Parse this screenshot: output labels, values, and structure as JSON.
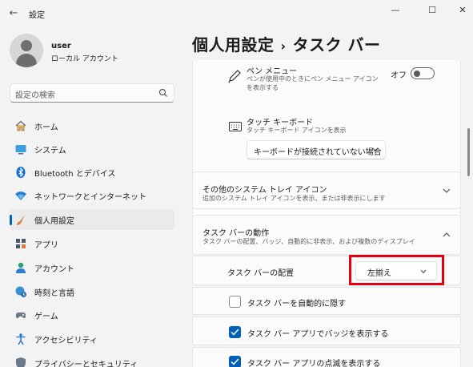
{
  "window": {
    "title": "設定",
    "back_icon": "←",
    "minimize": "—",
    "maximize": "☐",
    "close": "✕"
  },
  "profile": {
    "name": "user",
    "account_type": "ローカル アカウント"
  },
  "search": {
    "placeholder": "設定の検索"
  },
  "nav": {
    "items": [
      {
        "label": "ホーム",
        "icon": "home-icon"
      },
      {
        "label": "システム",
        "icon": "system-icon"
      },
      {
        "label": "Bluetooth とデバイス",
        "icon": "bluetooth-icon"
      },
      {
        "label": "ネットワークとインターネット",
        "icon": "network-icon"
      },
      {
        "label": "個人用設定",
        "icon": "personalization-icon",
        "active": true
      },
      {
        "label": "アプリ",
        "icon": "apps-icon"
      },
      {
        "label": "アカウント",
        "icon": "account-icon"
      },
      {
        "label": "時刻と言語",
        "icon": "time-language-icon"
      },
      {
        "label": "ゲーム",
        "icon": "gaming-icon"
      },
      {
        "label": "アクセシビリティ",
        "icon": "accessibility-icon"
      },
      {
        "label": "プライバシーとセキュリティ",
        "icon": "privacy-icon"
      }
    ]
  },
  "breadcrumb": {
    "parent": "個人用設定",
    "separator": "›",
    "current": "タスク バー"
  },
  "pen_menu": {
    "title": "ペン メニュー",
    "description": "ペンが使用中のときにペン メニュー アイコンを表示する",
    "toggle_label": "オフ",
    "toggle_on": false
  },
  "touch_keyboard": {
    "title": "タッチ キーボード",
    "description": "タッチ キーボード アイコンを表示",
    "dropdown_value": "キーボードが接続されていない場合"
  },
  "other_tray": {
    "title": "その他のシステム トレイ アイコン",
    "description": "追加のシステム トレイ アイコンを表示、または非表示にします"
  },
  "taskbar_behavior": {
    "title": "タスク バーの動作",
    "description": "タスク バーの配置、バッジ、自動的に非表示、および複数のディスプレイ",
    "alignment_label": "タスク バーの配置",
    "alignment_value": "左揃え",
    "options": [
      {
        "label": "タスク バーを自動的に隠す",
        "checked": false
      },
      {
        "label": "タスク バー アプリでバッジを表示する",
        "checked": true
      },
      {
        "label": "タスク バー アプリの点滅を表示する",
        "checked": true
      }
    ]
  },
  "colors": {
    "accent": "#005fb8",
    "highlight": "#e60012"
  }
}
